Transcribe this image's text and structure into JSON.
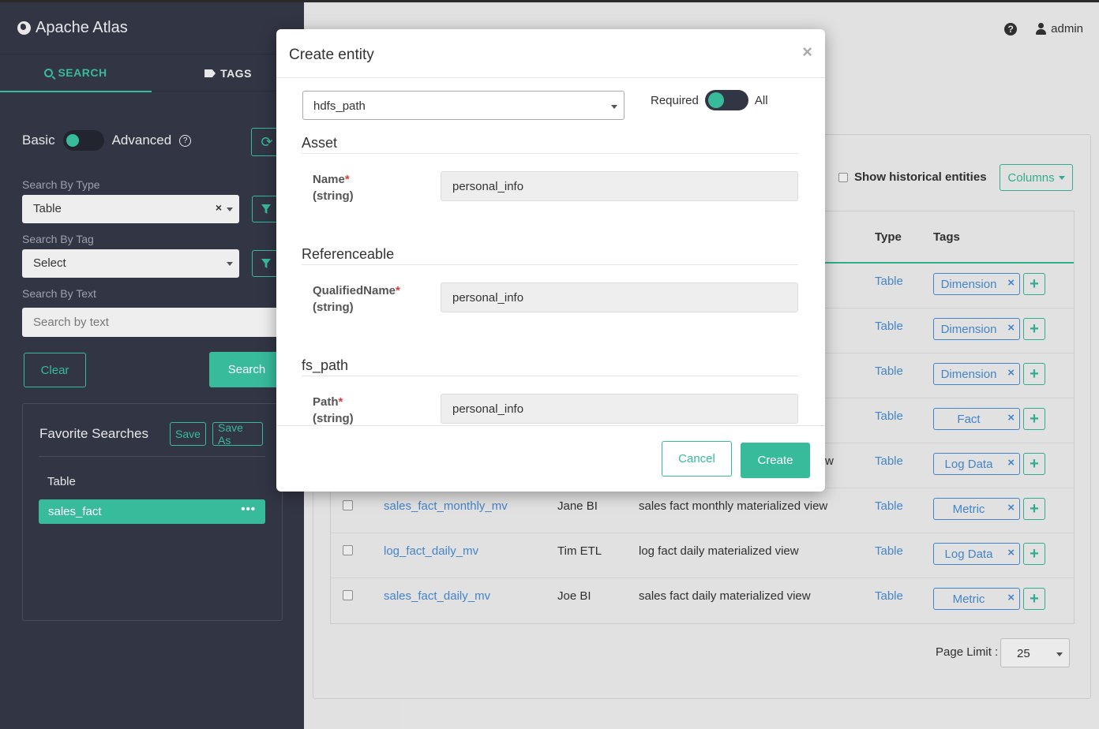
{
  "app": {
    "title": "Apache Atlas"
  },
  "sidebar": {
    "tabs": [
      {
        "label": "SEARCH"
      },
      {
        "label": "TAGS"
      }
    ],
    "mode": {
      "basic": "Basic",
      "advanced": "Advanced",
      "help": "?"
    },
    "search_by_type": {
      "label": "Search By Type",
      "value": "Table",
      "clear": "×"
    },
    "search_by_tag": {
      "label": "Search By Tag",
      "value": "Select"
    },
    "search_by_text": {
      "label": "Search By Text",
      "placeholder": "Search by text"
    },
    "clear_label": "Clear",
    "search_label": "Search",
    "favorites": {
      "title": "Favorite Searches",
      "save": "Save",
      "save_as": "Save As",
      "group": "Table",
      "items": [
        {
          "label": "sales_fact",
          "menu": "•••"
        }
      ]
    }
  },
  "header": {
    "help": "?",
    "user": "admin"
  },
  "results": {
    "show_historical": "Show historical entities",
    "columns_label": "Columns",
    "headers": {
      "type": "Type",
      "tags": "Tags"
    },
    "rows": [
      {
        "type": "Table",
        "tag": "Dimension"
      },
      {
        "type": "Table",
        "tag": "Dimension"
      },
      {
        "type": "Table",
        "tag": "Dimension"
      },
      {
        "type": "Table",
        "tag": "Fact"
      },
      {
        "partial": "w",
        "type": "Table",
        "tag": "Log Data"
      },
      {
        "name": "sales_fact_monthly_mv",
        "owner": "Jane BI",
        "description": "sales fact monthly materialized view",
        "type": "Table",
        "tag": "Metric"
      },
      {
        "name": "log_fact_daily_mv",
        "owner": "Tim ETL",
        "description": "log fact daily materialized view",
        "type": "Table",
        "tag": "Log Data"
      },
      {
        "name": "sales_fact_daily_mv",
        "owner": "Joe BI",
        "description": "sales fact daily materialized view",
        "type": "Table",
        "tag": "Metric"
      }
    ],
    "tag_remove": "×",
    "tag_add": "+",
    "page_limit_label": "Page Limit :",
    "page_limit_value": "25"
  },
  "modal": {
    "title": "Create entity",
    "close": "×",
    "type_value": "hdfs_path",
    "required_label": "Required",
    "all_label": "All",
    "sections": [
      {
        "title": "Asset",
        "attr_name": "Name",
        "attr_type": "(string)",
        "value": "personal_info"
      },
      {
        "title": "Referenceable",
        "attr_name": "QualifiedName",
        "attr_type": "(string)",
        "value": "personal_info"
      },
      {
        "title": "fs_path",
        "attr_name": "Path",
        "attr_type": "(string)",
        "value": "personal_info"
      }
    ],
    "required_mark": "*",
    "cancel_label": "Cancel",
    "create_label": "Create"
  },
  "colors": {
    "accent": "#37bb9b",
    "sidebar_bg": "#323544",
    "link": "#4a90d9",
    "required": "#e03a3a"
  }
}
